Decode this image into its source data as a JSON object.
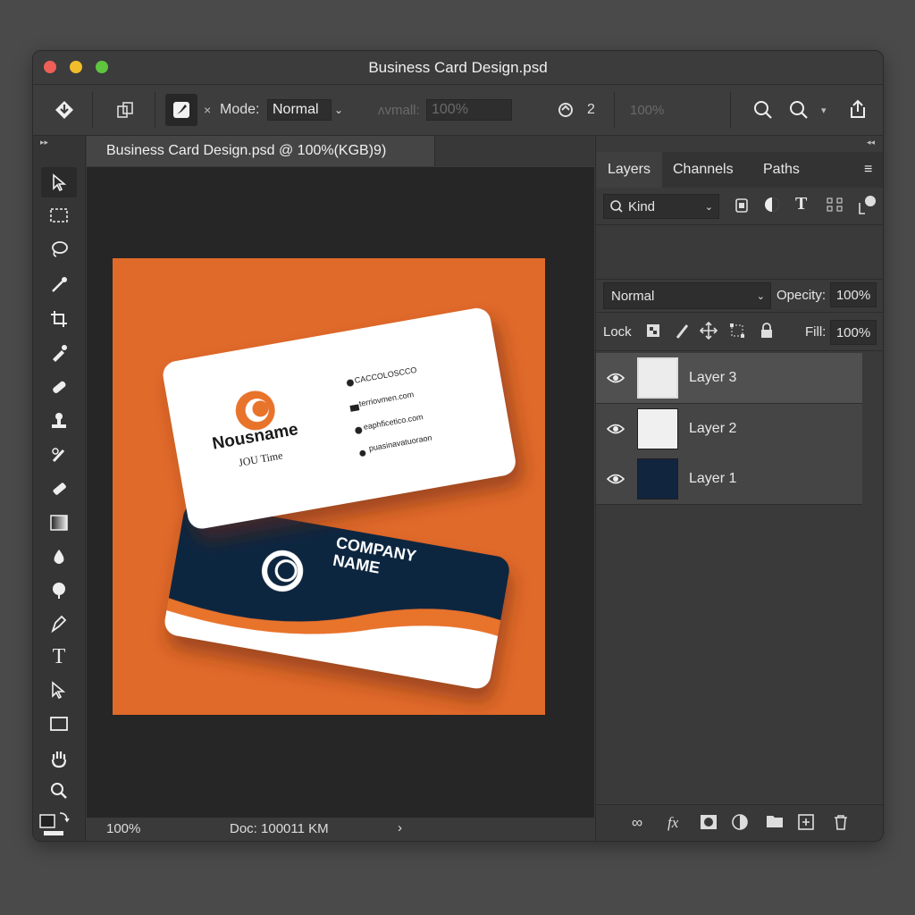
{
  "window": {
    "title": "Business Card Design.psd"
  },
  "options_bar": {
    "mode_label": "Mode:",
    "mode_value": "Normal",
    "faded_label": "ʌvmall:",
    "faded_value": "100%",
    "counter": "2",
    "faded_percent": "100%"
  },
  "document": {
    "tab_title": "Business Card Design.psd @ 100%(KGB)9)"
  },
  "artwork": {
    "front_card": {
      "name": "Nousname",
      "subtitle": "JOU Time",
      "contacts": [
        "CACCOLOSCCO",
        "terriovmen.com",
        "eaphficetico.com",
        "puasinavatuoraon"
      ]
    },
    "back_card": {
      "company_line1": "COMPANY",
      "company_line2": "NAME"
    }
  },
  "status": {
    "zoom": "100%",
    "doc_label": "Doc: 100011 KM",
    "arrow": "›"
  },
  "layers_panel": {
    "tabs": [
      "Layers",
      "Channels",
      "Paths"
    ],
    "filter_label": "Kind",
    "blend_mode": "Normal",
    "opacity_label": "Opecity:",
    "opacity_value": "100%",
    "lock_label": "Lock",
    "fill_label": "Fill:",
    "fill_value": "100%",
    "layers": [
      {
        "name": "Layer 3"
      },
      {
        "name": "Layer 2"
      },
      {
        "name": "Layer 1"
      }
    ]
  },
  "colors": {
    "accent_orange": "#e06a2a",
    "card_navy": "#11253f",
    "ui_dark": "#3b3b3b"
  }
}
